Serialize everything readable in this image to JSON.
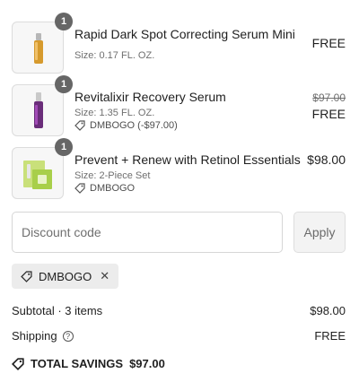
{
  "items": [
    {
      "quantity": "1",
      "name": "Rapid Dark Spot Correcting Serum Mini",
      "size": "Size: 0.17 FL. OZ.",
      "price": "FREE",
      "image": "serum-mini-bottle"
    },
    {
      "quantity": "1",
      "name": "Revitalixir Recovery Serum",
      "size": "Size: 1.35 FL. OZ.",
      "discount": "DMBOGO (-$97.00)",
      "original_price": "$97.00",
      "price": "FREE",
      "image": "serum-bottle-purple"
    },
    {
      "quantity": "1",
      "name": "Prevent + Renew with Retinol Essentials",
      "size": "Size: 2-Piece Set",
      "discount": "DMBOGO",
      "price": "$98.00",
      "image": "retinol-set-box"
    }
  ],
  "discount": {
    "placeholder": "Discount code",
    "apply_label": "Apply",
    "applied_code": "DMBOGO",
    "remove_symbol": "✕"
  },
  "summary": {
    "subtotal_label": "Subtotal · 3 items",
    "subtotal_value": "$98.00",
    "shipping_label": "Shipping",
    "shipping_value": "FREE",
    "savings_label": "TOTAL SAVINGS",
    "savings_value": "$97.00"
  },
  "colors": {
    "badge": "#666666",
    "chip_bg": "#ececec",
    "input_border": "#d6d6d6"
  }
}
